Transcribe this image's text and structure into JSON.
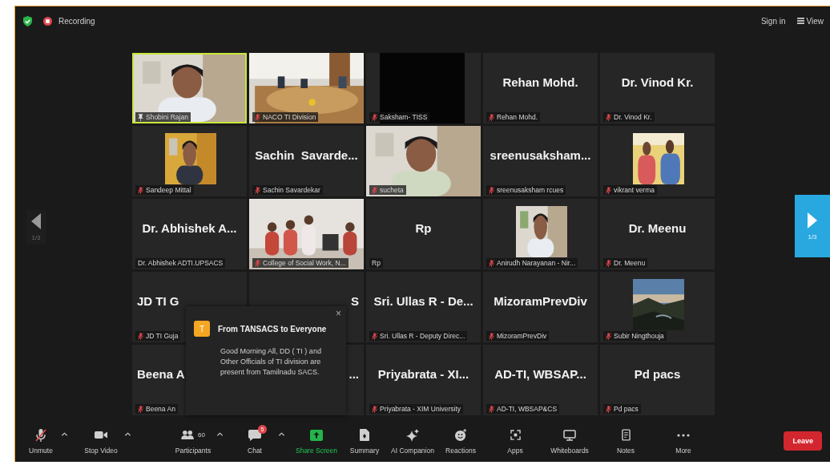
{
  "top_bar": {
    "recording_label": "Recording",
    "sign_in": "Sign in",
    "view": "View"
  },
  "pager": {
    "left_page": "1/3",
    "right_page": "1/3"
  },
  "tiles": [
    {
      "kind": "video",
      "label": "Shobini Rajan",
      "muted": false,
      "pinned": true,
      "speaking": true
    },
    {
      "kind": "video",
      "label": "NACO TI Division",
      "muted": true
    },
    {
      "kind": "dark",
      "label": "Saksham- TISS",
      "muted": true
    },
    {
      "kind": "name",
      "name": "Rehan Mohd.",
      "label": "Rehan Mohd.",
      "muted": true
    },
    {
      "kind": "name",
      "name": "Dr. Vinod Kr.",
      "label": "Dr. Vinod Kr.",
      "muted": true
    },
    {
      "label": "Sandeep Mittal",
      "muted": true
    },
    {
      "kind": "name",
      "name": "Sachin  Savarde...",
      "label": "Sachin Savardekar",
      "muted": true
    },
    {
      "kind": "video",
      "label": "sucheta",
      "muted": true
    },
    {
      "kind": "name",
      "name": "sreenusaksham...",
      "label": "sreenusaksham rcues",
      "muted": true
    },
    {
      "label": "vikrant verma",
      "muted": true
    },
    {
      "kind": "name",
      "name": "Dr. Abhishek A...",
      "label": "Dr. Abhishek ADTI.UPSACS",
      "muted": false
    },
    {
      "kind": "video",
      "label": "College of Social Work, N...",
      "muted": true
    },
    {
      "kind": "name",
      "name": "Rp",
      "label": "Rp",
      "muted": false
    },
    {
      "label": "Anirudh Narayanan - Nir...",
      "muted": true
    },
    {
      "kind": "name",
      "name": "Dr. Meenu",
      "label": "Dr. Meenu",
      "muted": true
    },
    {
      "kind": "name",
      "name": "JD TI G",
      "label": "JD TI Guja",
      "muted": true
    },
    {
      "kind": "name",
      "name": "S"
    },
    {
      "kind": "name",
      "name": "Sri. Ullas R - De...",
      "label": "Sri. Ullas R - Deputy Direc...",
      "muted": true
    },
    {
      "kind": "name",
      "name": "MizoramPrevDiv",
      "label": "MizoramPrevDiv",
      "muted": true
    },
    {
      "label": "Subir Ningthouja",
      "muted": true
    },
    {
      "kind": "name",
      "name": "Beena A",
      "label": "Beena An",
      "muted": true
    },
    {
      "kind": "name",
      "name": "..."
    },
    {
      "kind": "name",
      "name": "Priyabrata - XI...",
      "label": "Priyabrata - XIM University",
      "muted": true
    },
    {
      "kind": "name",
      "name": "AD-TI, WBSAP...",
      "label": "AD-TI, WBSAP&CS",
      "muted": true
    },
    {
      "kind": "name",
      "name": "Pd pacs",
      "label": "Pd pacs",
      "muted": true
    }
  ],
  "chat_popup": {
    "avatar": "T",
    "title": "From TANSACS to Everyone",
    "message": "Good Morning All, DD ( TI ) and Other Officials of TI division are present from Tamilnadu SACS.",
    "close": "×"
  },
  "toolbar": [
    {
      "kind": "mic",
      "label": "Unmute",
      "muted": true,
      "has_menu": true
    },
    {
      "kind": "video",
      "label": "Stop Video",
      "has_menu": true
    },
    {
      "kind": "participants",
      "label": "Participants",
      "count": "60",
      "has_menu": true
    },
    {
      "kind": "chat",
      "label": "Chat",
      "badge": "5",
      "has_menu": true
    },
    {
      "kind": "share",
      "label": "Share Screen"
    },
    {
      "kind": "summary",
      "label": "Summary"
    },
    {
      "kind": "ai",
      "label": "AI Companion"
    },
    {
      "kind": "reactions",
      "label": "Reactions"
    },
    {
      "kind": "apps",
      "label": "Apps"
    },
    {
      "kind": "whiteboard",
      "label": "Whiteboards"
    },
    {
      "kind": "notes",
      "label": "Notes"
    },
    {
      "kind": "more",
      "label": "More"
    }
  ],
  "leave": "Leave"
}
